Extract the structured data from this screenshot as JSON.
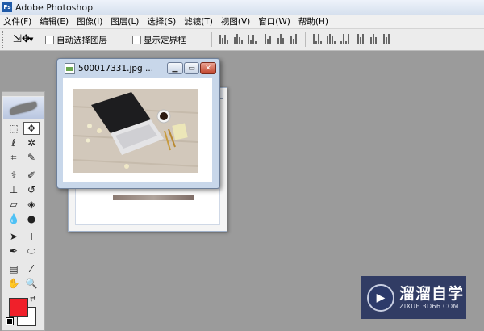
{
  "app": {
    "title": "Adobe Photoshop",
    "icon_label": "Ps"
  },
  "menubar": {
    "items": [
      "文件(F)",
      "编辑(E)",
      "图像(I)",
      "图层(L)",
      "选择(S)",
      "滤镜(T)",
      "视图(V)",
      "窗口(W)",
      "帮助(H)"
    ]
  },
  "options": {
    "auto_select_label": "自动选择图层",
    "auto_select_checked": false,
    "show_bounds_label": "显示定界框",
    "show_bounds_checked": false
  },
  "toolbox": {
    "tools": [
      "rectangular-marquee",
      "move",
      "lasso",
      "magic-wand",
      "crop",
      "slice",
      "healing-brush",
      "brush",
      "clone-stamp",
      "history-brush",
      "eraser",
      "paint-bucket",
      "blur",
      "dodge",
      "path-selection",
      "type",
      "pen",
      "custom-shape",
      "notes",
      "eyedropper",
      "hand",
      "zoom"
    ],
    "selected_tool": "move",
    "foreground_color": "#f0202a",
    "background_color": "#ffffff"
  },
  "document": {
    "filename": "500017331.jpg ...",
    "photo_description_icon": "image-icon"
  },
  "watermark": {
    "main": "溜溜自学",
    "sub": "ZIXUE.3D66.COM"
  }
}
